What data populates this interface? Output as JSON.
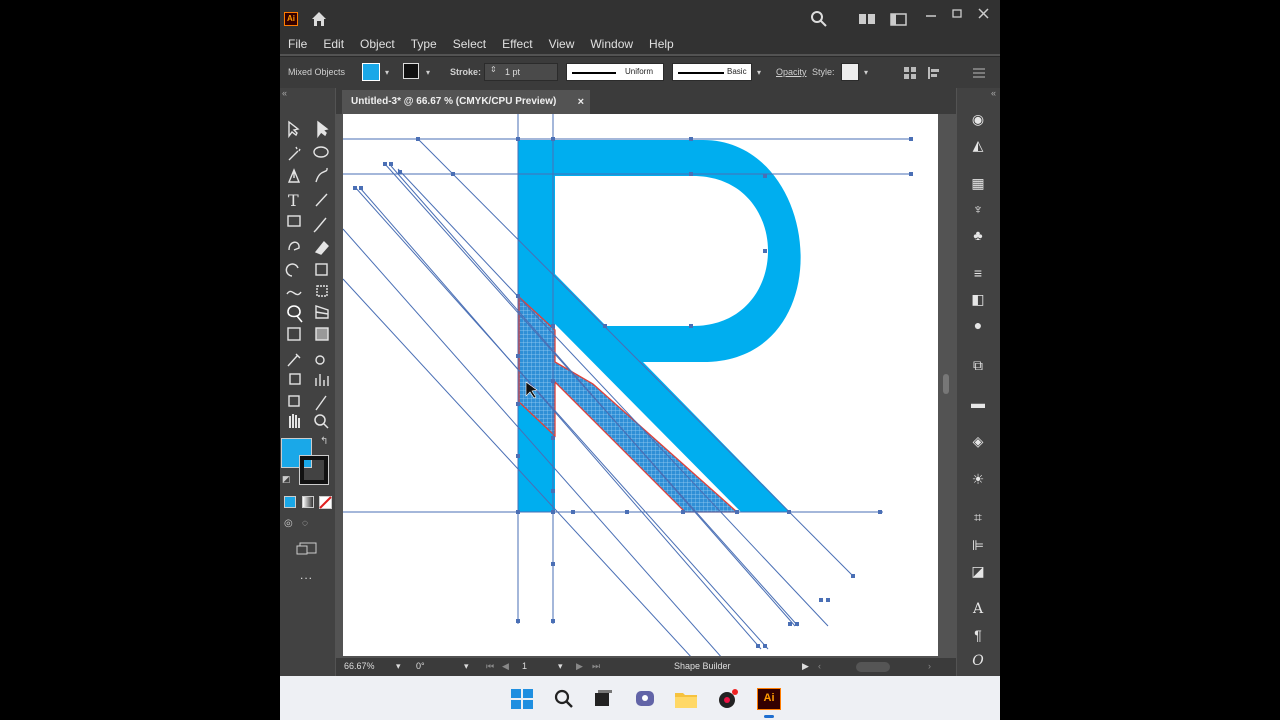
{
  "menu": [
    "File",
    "Edit",
    "Object",
    "Type",
    "Select",
    "Effect",
    "View",
    "Window",
    "Help"
  ],
  "control": {
    "selection_label": "Mixed Objects",
    "stroke_label": "Stroke:",
    "stroke_value": "1 pt",
    "profile_uniform": "Uniform",
    "brush_basic": "Basic",
    "opacity_label": "Opacity",
    "style_label": "Style:",
    "fill_color": "#1aa8e8"
  },
  "document": {
    "tab_title": "Untitled-3* @ 66.67 % (CMYK/CPU Preview)",
    "close": "×"
  },
  "colors": {
    "fill": "#00aeef",
    "guide": "#4a6fb5",
    "shape_builder_hatch": "#2f8fd6",
    "outline_red": "#e0413a"
  },
  "status": {
    "zoom": "66.67%",
    "rotation": "0°",
    "artboard": "1",
    "tool": "Shape Builder"
  },
  "tools": {
    "more": "..."
  }
}
